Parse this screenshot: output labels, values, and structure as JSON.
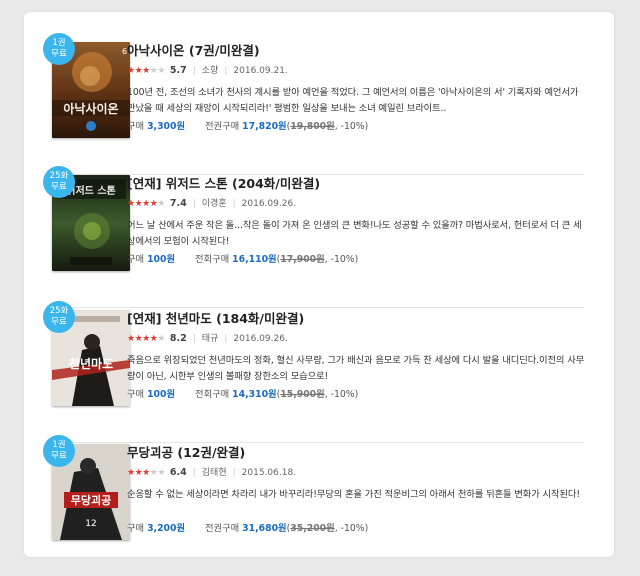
{
  "books": [
    {
      "badge": [
        "1권",
        "무료"
      ],
      "title": "아낙사이온 (7권/미완결)",
      "stars_filled": 3,
      "rating": "5.7",
      "author": "소향",
      "date": "2016.09.21.",
      "desc": "100년 전, 조선의 소녀가 천사의 계시를 받아 예언을 적었다. 그 예언서의 이름은 '아낙사이온의 서' 기록자와 예언서가 만났을 때 세상의 재앙이 시작되리라!' 평범한 일상을 보내는 소녀 예일린 브라이트..",
      "buy_label": "구매",
      "buy_price": "3,300원",
      "all_label": "전권구매",
      "all_price": "17,820원",
      "paren_open": "(",
      "original_price": "19,800원",
      "discount": ", -10%)",
      "cover_color": "#6b3a1c",
      "cover_text": "아낙사이온"
    },
    {
      "badge": [
        "25화",
        "무료"
      ],
      "title": "[연재] 위저드 스톤 (204화/미완결)",
      "stars_filled": 4,
      "rating": "7.4",
      "author": "이경훈",
      "date": "2016.09.26.",
      "desc": "어느 날 산에서 주운 작은 돌...작은 돌이 가져 온 인생의 큰 변화!나도 성공할 수 있을까? 마법사로서, 헌터로서 더 큰 세상에서의 모험이 시작된다!",
      "buy_label": "구매",
      "buy_price": "100원",
      "all_label": "전회구매",
      "all_price": "16,110원",
      "paren_open": "(",
      "original_price": "17,900원",
      "discount": ", -10%)",
      "cover_color": "#2c3b22",
      "cover_text": "위저드 스톤"
    },
    {
      "badge": [
        "25화",
        "무료"
      ],
      "title": "[연재] 천년마도 (184화/미완결)",
      "stars_filled": 4,
      "rating": "8.2",
      "author": "태규",
      "date": "2016.09.26.",
      "desc": "죽음으로 위장되었던 천년마도의 정화, 혈신 사무량, 그가 배신과 음모로 가득 찬 세상에 다시 발을 내디딘다.이전의 사무량이 아닌, 시한부 인생의 볼패향 장한소의 모습으로!",
      "buy_label": "구매",
      "buy_price": "100원",
      "all_label": "전회구매",
      "all_price": "14,310원",
      "paren_open": "(",
      "original_price": "15,900원",
      "discount": ", -10%)",
      "cover_color": "#3a2a22",
      "cover_text": "천년마도"
    },
    {
      "badge": [
        "1권",
        "무료"
      ],
      "title": "무당괴공 (12권/완결)",
      "stars_filled": 3,
      "rating": "6.4",
      "author": "김태현",
      "date": "2015.06.18.",
      "desc": "순응할 수 없는 세상이라면 차라리 내가 바꾸리라!무당의 혼을 가진 적운비그의 아래서 천하를 뒤흔들 변화가 시작된다!",
      "buy_label": "구매",
      "buy_price": "3,200원",
      "all_label": "전권구매",
      "all_price": "31,680원",
      "paren_open": "(",
      "original_price": "35,200원",
      "discount": ", -10%)",
      "cover_color": "#2b2b2b",
      "cover_text": "무당괴공"
    }
  ]
}
